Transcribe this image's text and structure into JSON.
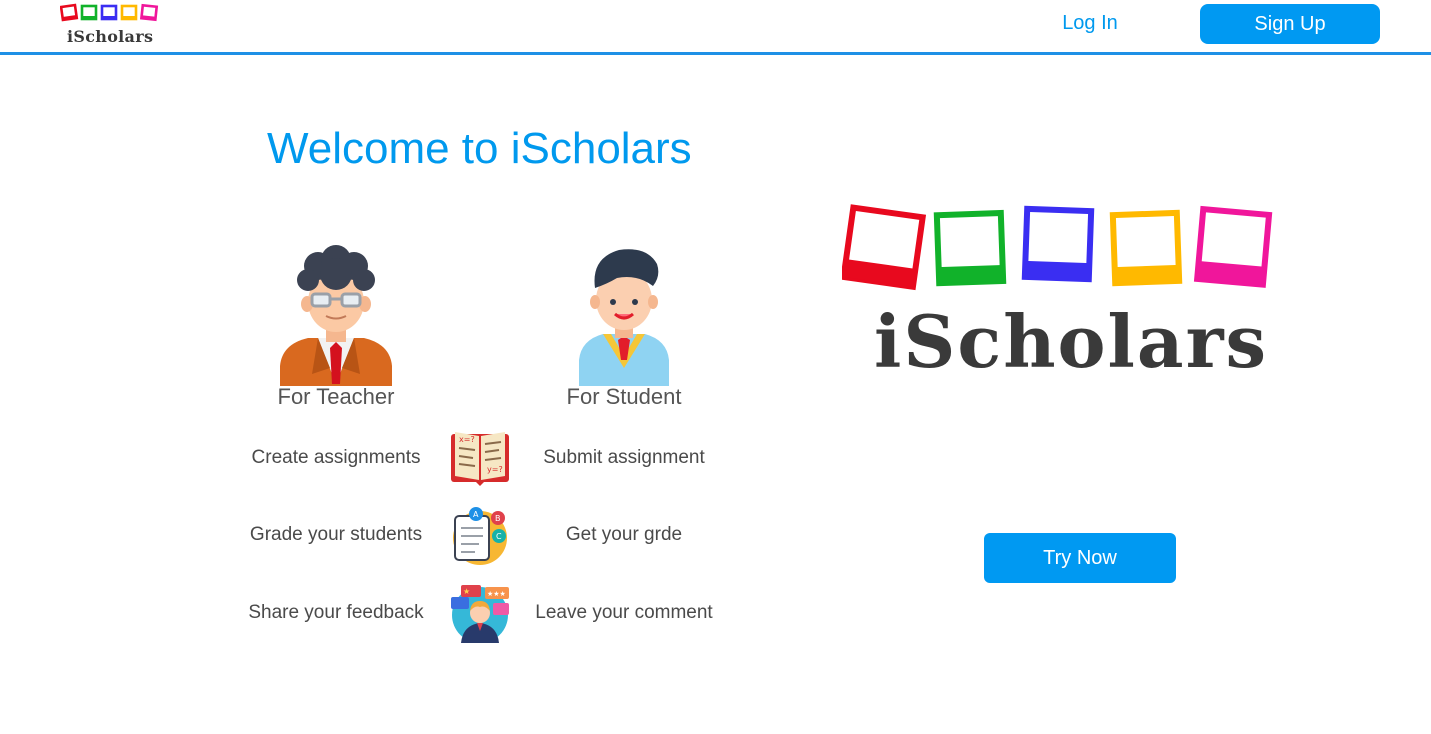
{
  "header": {
    "logo_text": "iScholars",
    "login_label": "Log In",
    "signup_label": "Sign Up"
  },
  "hero": {
    "title": "Welcome to iScholars",
    "teacher_label": "For Teacher",
    "student_label": "For Student",
    "features": [
      {
        "teacher": "Create assignments",
        "icon": "open-book-icon",
        "student": "Submit assignment"
      },
      {
        "teacher": "Grade your students",
        "icon": "graded-paper-icon",
        "student": "Get your grde"
      },
      {
        "teacher": "Share your feedback",
        "icon": "feedback-person-icon",
        "student": "Leave your comment"
      }
    ]
  },
  "brand": {
    "logo_text": "iScholars",
    "frame_colors": [
      "#e8091e",
      "#11b22a",
      "#3a2ef2",
      "#ffb900",
      "#f0169b"
    ],
    "accent": "#0099f2",
    "text_dark": "#3a3a3a"
  },
  "cta": {
    "try_now_label": "Try Now"
  }
}
